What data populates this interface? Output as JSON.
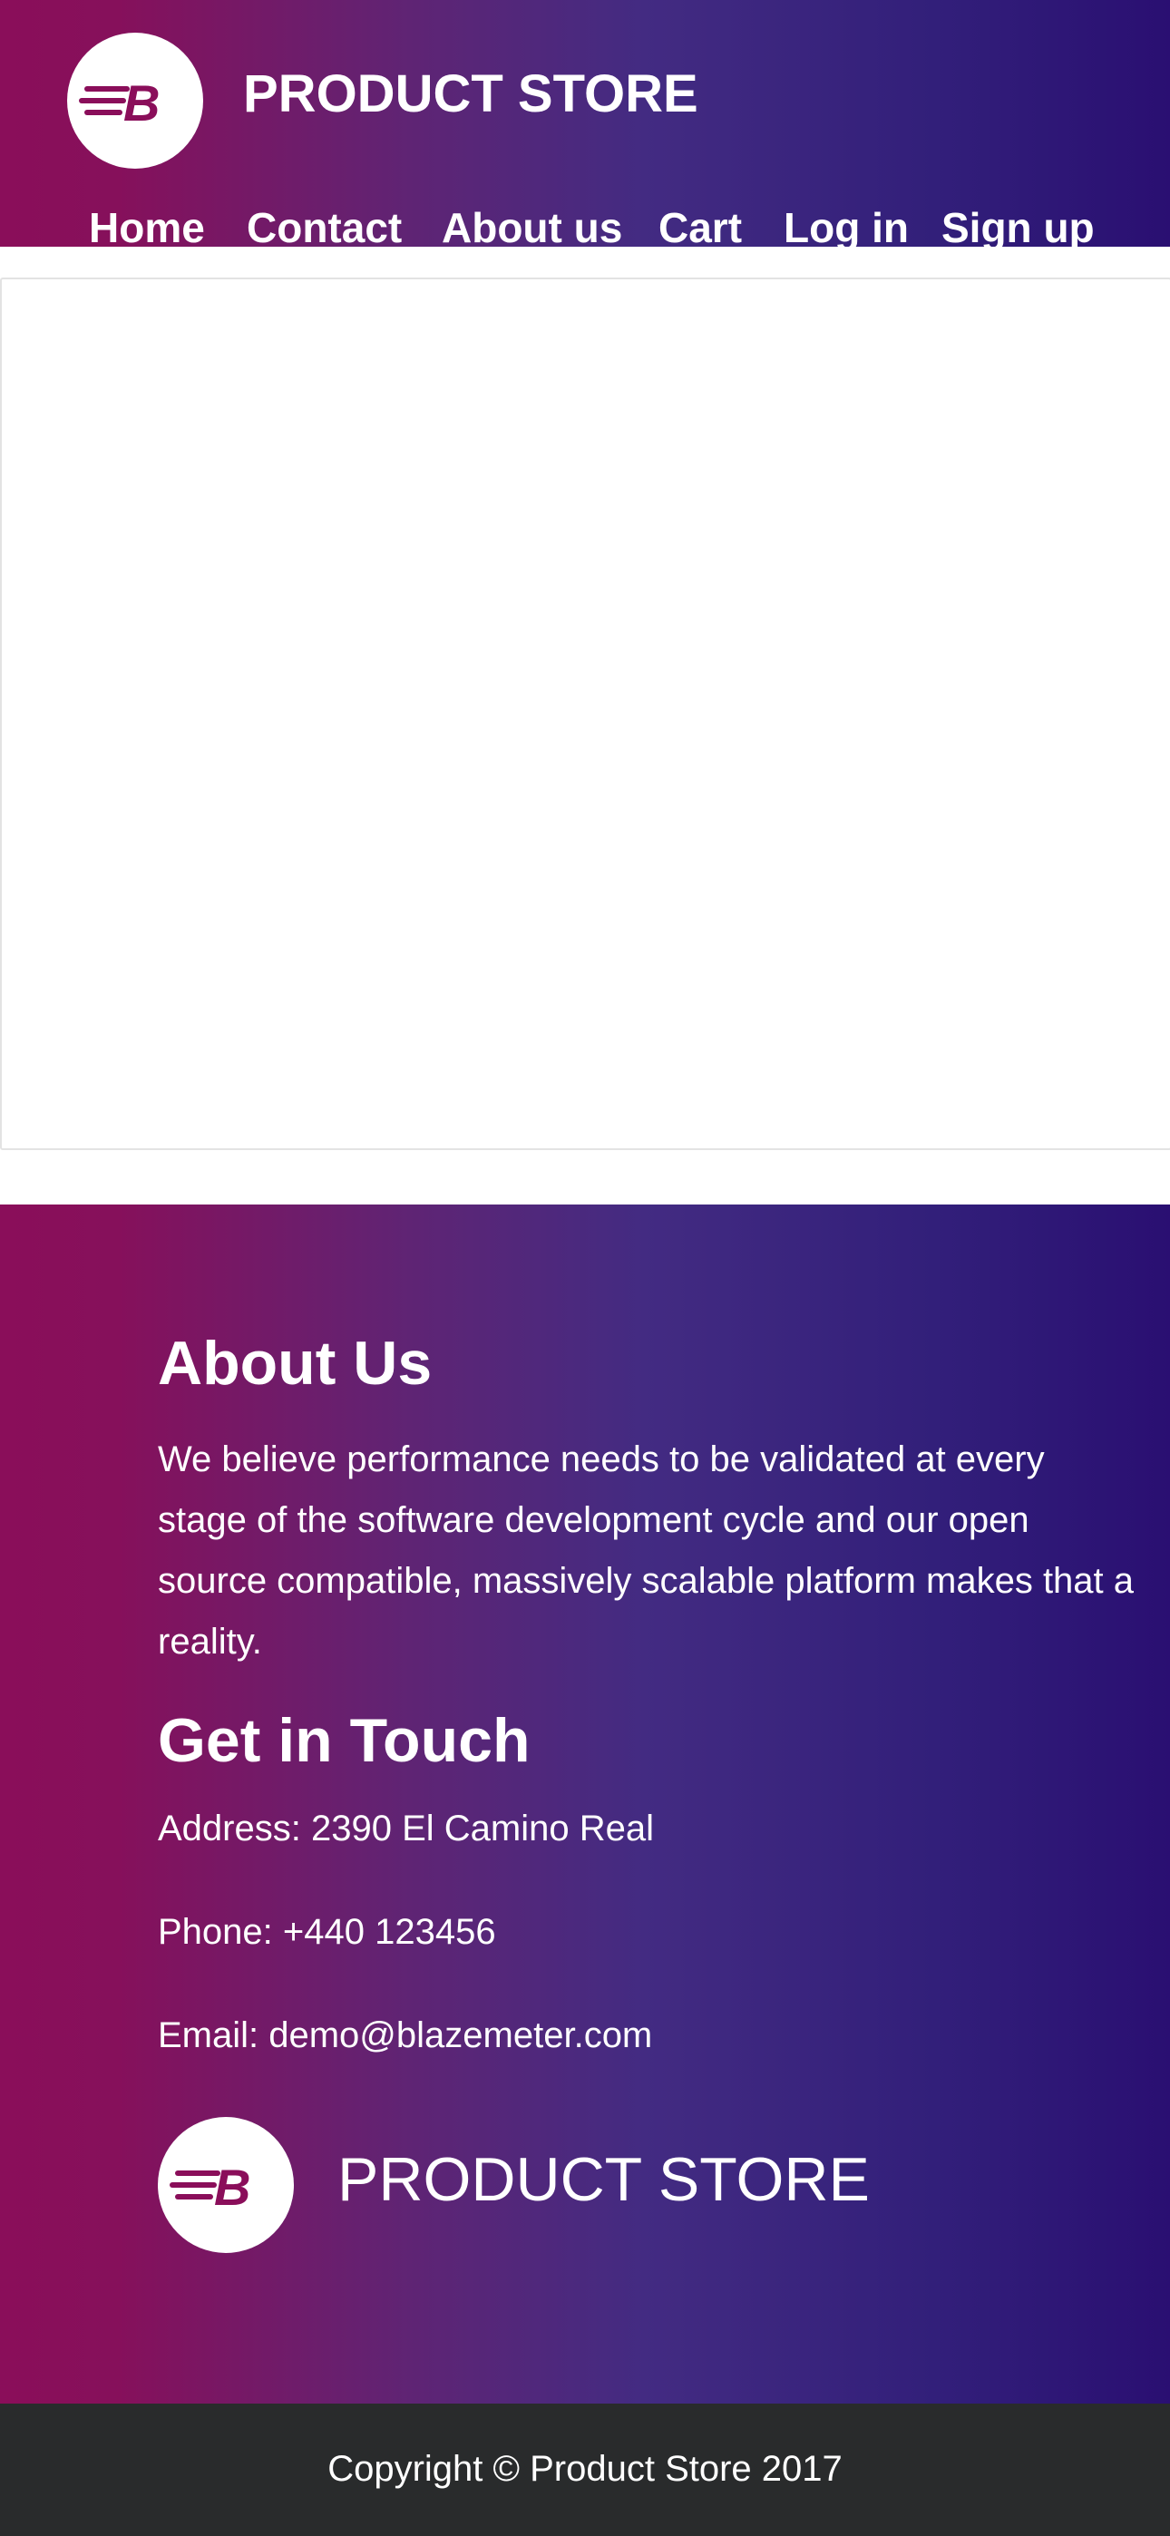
{
  "header": {
    "brand": "PRODUCT STORE",
    "logo_icon": "blazemeter-b-logo-icon",
    "nav": {
      "home": "Home",
      "contact": "Contact",
      "about": "About us",
      "cart": "Cart",
      "login": "Log in",
      "signup": "Sign up"
    }
  },
  "footer": {
    "about_heading": "About Us",
    "about_text": "We believe performance needs to be validated at every stage of the software development cycle and our open source compatible, massively scalable platform makes that a reality.",
    "touch_heading": "Get in Touch",
    "address": "Address: 2390 El Camino Real",
    "phone": "Phone: +440 123456",
    "email": "Email: demo@blazemeter.com",
    "brand": "PRODUCT STORE"
  },
  "copyright": "Copyright © Product Store 2017",
  "colors": {
    "gradient_start": "#8a0e5a",
    "gradient_end": "#2a0f72",
    "logo_mark": "#8a0e5a",
    "copyright_bg": "#292b2c"
  }
}
